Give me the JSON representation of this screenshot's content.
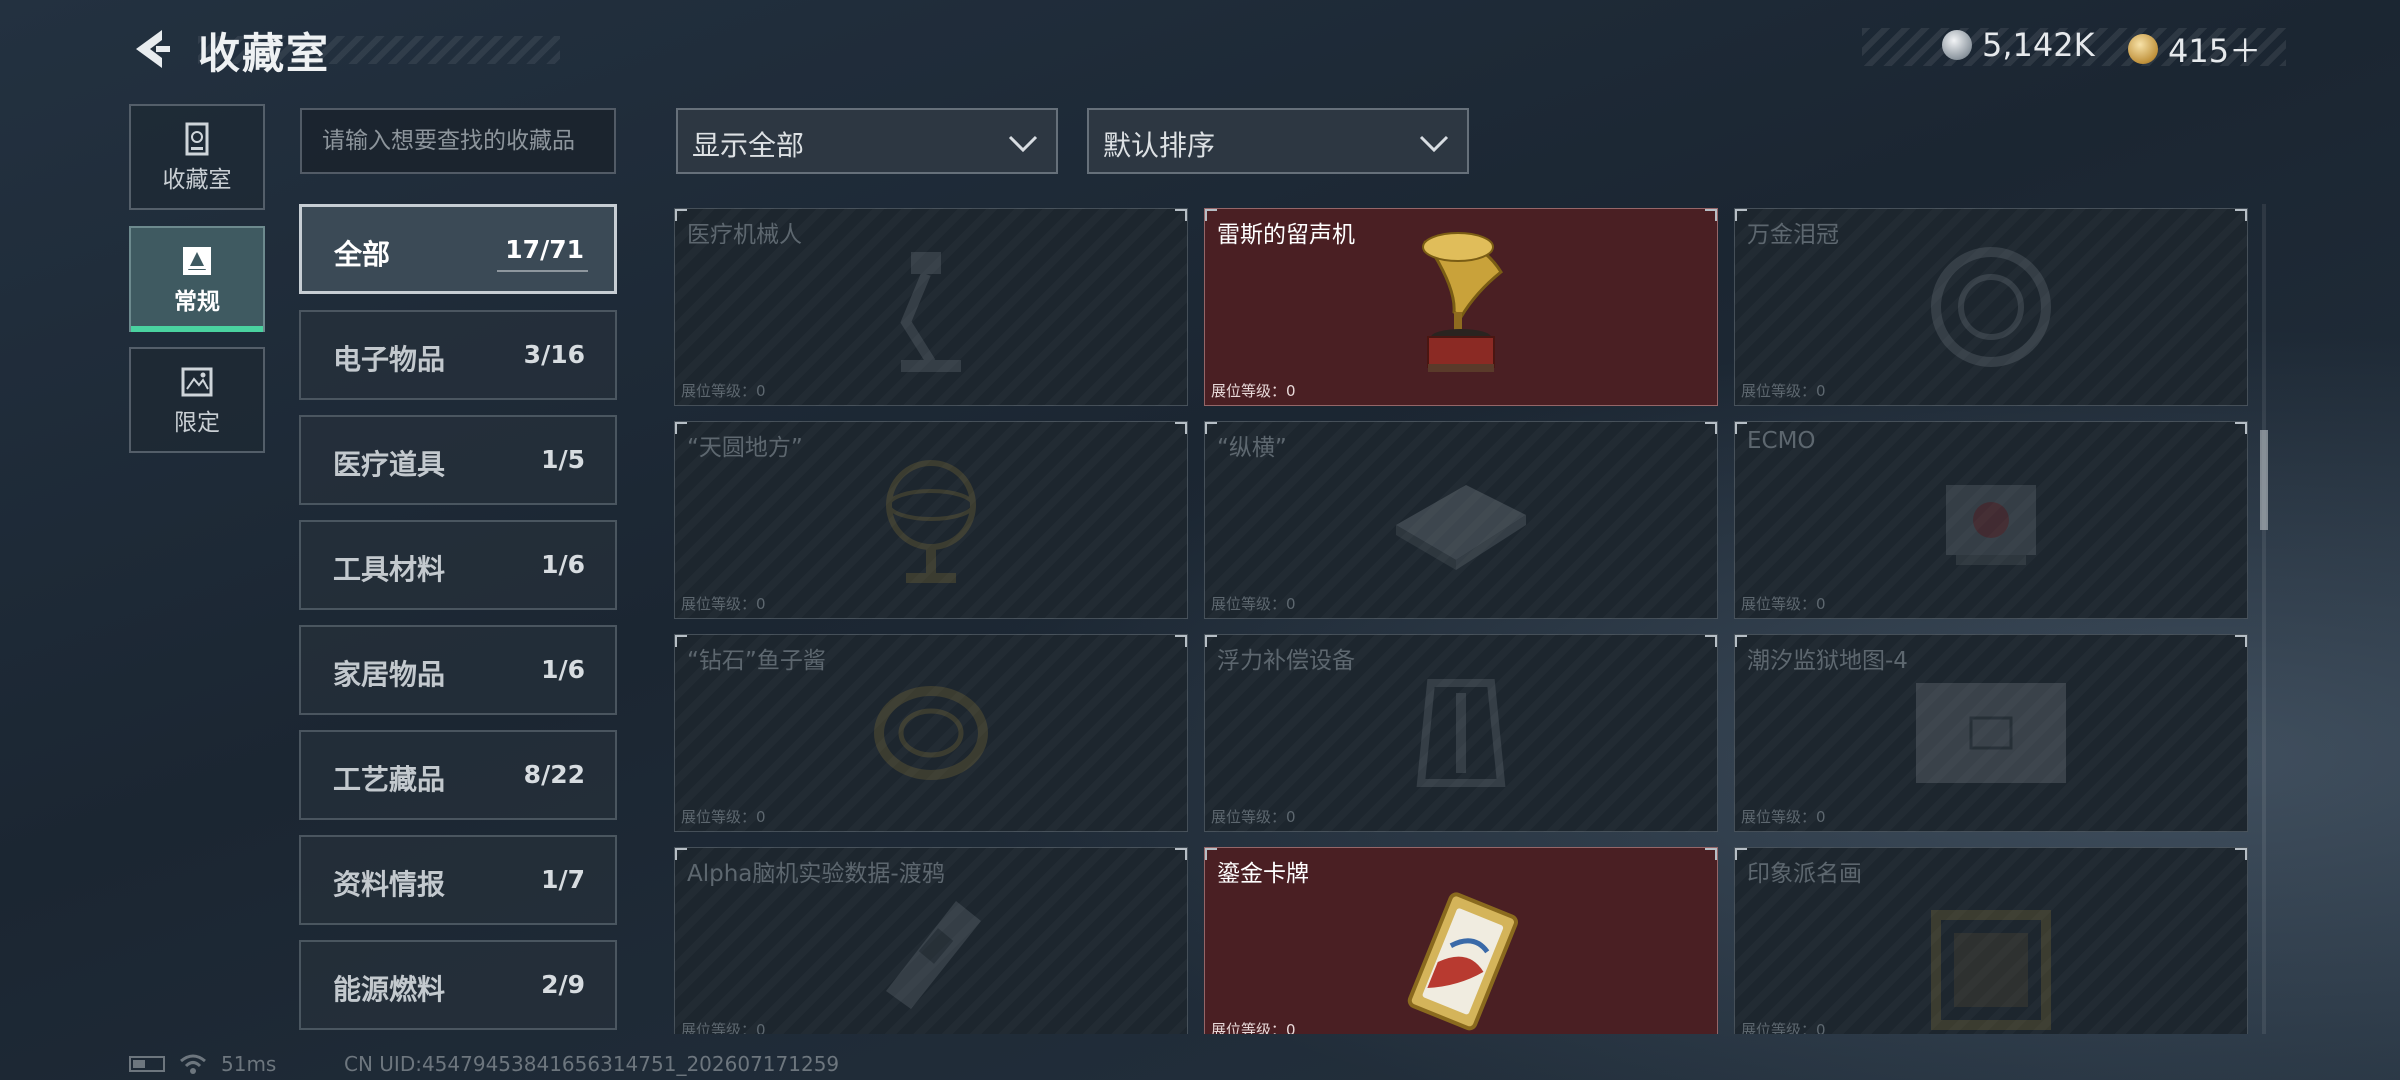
{
  "header": {
    "title": "收藏室",
    "currency_silver": "5,142K",
    "currency_gold": "415＋"
  },
  "side_tabs": [
    {
      "label": "收藏室",
      "active": false
    },
    {
      "label": "常规",
      "active": true
    },
    {
      "label": "限定",
      "active": false
    }
  ],
  "search": {
    "placeholder": "请输入想要查找的收藏品"
  },
  "categories": [
    {
      "name": "全部",
      "count": "17/71",
      "active": true
    },
    {
      "name": "电子物品",
      "count": "3/16"
    },
    {
      "name": "医疗道具",
      "count": "1/5"
    },
    {
      "name": "工具材料",
      "count": "1/6"
    },
    {
      "name": "家居物品",
      "count": "1/6"
    },
    {
      "name": "工艺藏品",
      "count": "8/22"
    },
    {
      "name": "资料情报",
      "count": "1/7"
    },
    {
      "name": "能源燃料",
      "count": "2/9"
    }
  ],
  "filters": {
    "display": "显示全部",
    "sort": "默认排序"
  },
  "items": [
    {
      "name": "医疗机械人",
      "level": "展位等级：0",
      "owned": false,
      "icon": "robot-arm-icon"
    },
    {
      "name": "雷斯的留声机",
      "level": "展位等级：0",
      "owned": true,
      "icon": "gramophone-icon"
    },
    {
      "name": "万金泪冠",
      "level": "展位等级：0",
      "owned": false,
      "icon": "crown-icon"
    },
    {
      "name": "“天圆地方”",
      "level": "展位等级：0",
      "owned": false,
      "icon": "armillary-icon"
    },
    {
      "name": "“纵横”",
      "level": "展位等级：0",
      "owned": false,
      "icon": "chessboard-icon"
    },
    {
      "name": "ECMO",
      "level": "展位等级：0",
      "owned": false,
      "icon": "ecmo-machine-icon"
    },
    {
      "name": "“钻石”鱼子酱",
      "level": "展位等级：0",
      "owned": false,
      "icon": "caviar-tin-icon"
    },
    {
      "name": "浮力补偿设备",
      "level": "展位等级：0",
      "owned": false,
      "icon": "bcd-vest-icon"
    },
    {
      "name": "潮汐监狱地图-4",
      "level": "展位等级：0",
      "owned": false,
      "icon": "map-icon"
    },
    {
      "name": "Alpha脑机实验数据-渡鸦",
      "level": "展位等级：0",
      "owned": false,
      "icon": "data-drive-icon"
    },
    {
      "name": "鎏金卡牌",
      "level": "展位等级：0",
      "owned": true,
      "icon": "gilded-card-icon"
    },
    {
      "name": "印象派名画",
      "level": "展位等级：0",
      "owned": false,
      "icon": "painting-icon"
    }
  ],
  "footer": {
    "ping": "51ms",
    "uid": "CN UID:4547945384165631475​1_202607171259"
  }
}
